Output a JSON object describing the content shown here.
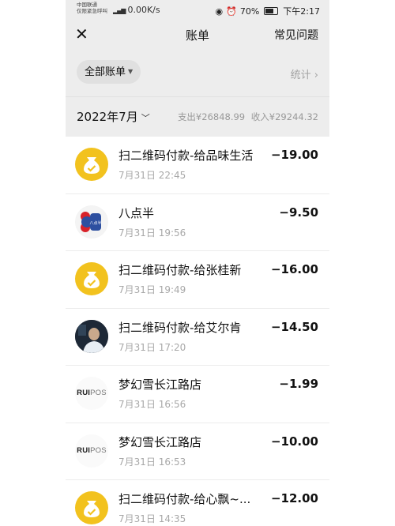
{
  "status_bar": {
    "carrier_line1": "中国联通",
    "carrier_line2": "仅限紧急呼叫",
    "network_speed": "0.00K/s",
    "battery_percent": "70%",
    "time": "下午2:17"
  },
  "header": {
    "title": "账单",
    "faq_label": "常见问题"
  },
  "filter": {
    "all_bills_label": "全部账单",
    "stats_label": "统计"
  },
  "month_summary": {
    "month": "2022年7月",
    "expense": "支出¥26848.99",
    "income": "收入¥29244.32"
  },
  "transactions": [
    {
      "name": "扫二维码付款-给品味生活",
      "time": "7月31日 22:45",
      "amount": "−19.00",
      "avatar": "qr-pay-icon"
    },
    {
      "name": "八点半",
      "time": "7月31日 19:56",
      "amount": "−9.50",
      "avatar": "merchant-logo"
    },
    {
      "name": "扫二维码付款-给张桂新",
      "time": "7月31日 19:49",
      "amount": "−16.00",
      "avatar": "qr-pay-icon"
    },
    {
      "name": "扫二维码付款-给艾尔肯",
      "time": "7月31日 17:20",
      "amount": "−14.50",
      "avatar": "user-photo"
    },
    {
      "name": "梦幻雪长江路店",
      "time": "7月31日 16:56",
      "amount": "−1.99",
      "avatar": "ruipos-logo"
    },
    {
      "name": "梦幻雪长江路店",
      "time": "7月31日 16:53",
      "amount": "−10.00",
      "avatar": "ruipos-logo"
    },
    {
      "name": "扫二维码付款-给心飘~...",
      "time": "7月31日 14:35",
      "amount": "−12.00",
      "avatar": "qr-pay-icon"
    }
  ],
  "logos": {
    "bdb_text": "八点半",
    "ruipos_a": "RUI",
    "ruipos_b": "POS"
  },
  "colors": {
    "qr_icon_bg": "#f2c21e",
    "header_bg": "#ededed"
  }
}
